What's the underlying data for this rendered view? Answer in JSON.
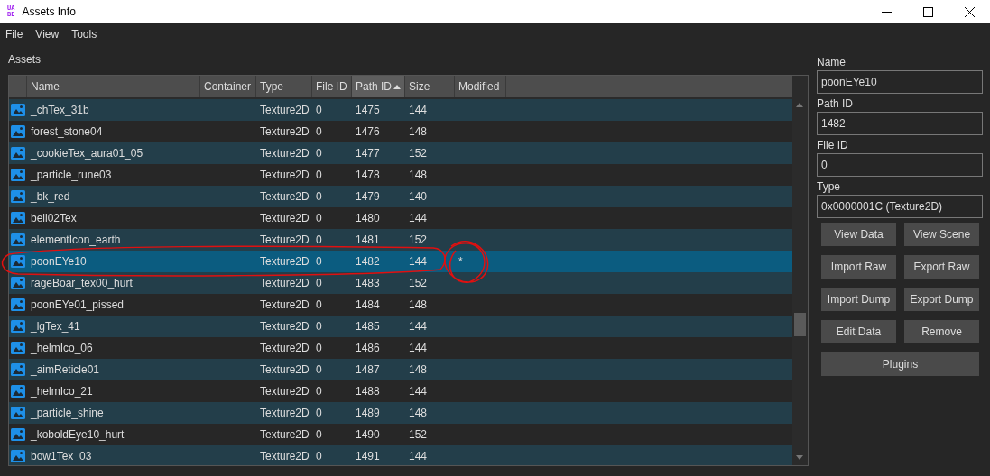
{
  "window": {
    "title": "Assets Info",
    "logo_lines": [
      "UA",
      "BE"
    ]
  },
  "menu": [
    "File",
    "View",
    "Tools"
  ],
  "section_label": "Assets",
  "table": {
    "columns": [
      {
        "label": "Name",
        "sorted_ascending": false
      },
      {
        "label": "Container",
        "sorted_ascending": false
      },
      {
        "label": "Type",
        "sorted_ascending": false
      },
      {
        "label": "File ID",
        "sorted_ascending": false
      },
      {
        "label": "Path ID",
        "sorted_ascending": true
      },
      {
        "label": "Size",
        "sorted_ascending": false
      },
      {
        "label": "Modified",
        "sorted_ascending": false
      }
    ],
    "rows": [
      {
        "name": "_chTex_31b",
        "type": "Texture2D",
        "file_id": "0",
        "path_id": "1475",
        "size": "144",
        "selected": false
      },
      {
        "name": "forest_stone04",
        "type": "Texture2D",
        "file_id": "0",
        "path_id": "1476",
        "size": "148",
        "selected": false
      },
      {
        "name": "_cookieTex_aura01_05",
        "type": "Texture2D",
        "file_id": "0",
        "path_id": "1477",
        "size": "152",
        "selected": false
      },
      {
        "name": "_particle_rune03",
        "type": "Texture2D",
        "file_id": "0",
        "path_id": "1478",
        "size": "148",
        "selected": false
      },
      {
        "name": "_bk_red",
        "type": "Texture2D",
        "file_id": "0",
        "path_id": "1479",
        "size": "140",
        "selected": false
      },
      {
        "name": "bell02Tex",
        "type": "Texture2D",
        "file_id": "0",
        "path_id": "1480",
        "size": "144",
        "selected": false
      },
      {
        "name": "elementIcon_earth",
        "type": "Texture2D",
        "file_id": "0",
        "path_id": "1481",
        "size": "152",
        "selected": false
      },
      {
        "name": "poonEYe10",
        "type": "Texture2D",
        "file_id": "0",
        "path_id": "1482",
        "size": "144",
        "modified": "*",
        "selected": true
      },
      {
        "name": "rageBoar_tex00_hurt",
        "type": "Texture2D",
        "file_id": "0",
        "path_id": "1483",
        "size": "152",
        "selected": false
      },
      {
        "name": "poonEYe01_pissed",
        "type": "Texture2D",
        "file_id": "0",
        "path_id": "1484",
        "size": "148",
        "selected": false
      },
      {
        "name": "_lgTex_41",
        "type": "Texture2D",
        "file_id": "0",
        "path_id": "1485",
        "size": "144",
        "selected": false
      },
      {
        "name": "_helmIco_06",
        "type": "Texture2D",
        "file_id": "0",
        "path_id": "1486",
        "size": "144",
        "selected": false
      },
      {
        "name": "_aimReticle01",
        "type": "Texture2D",
        "file_id": "0",
        "path_id": "1487",
        "size": "148",
        "selected": false
      },
      {
        "name": "_helmIco_21",
        "type": "Texture2D",
        "file_id": "0",
        "path_id": "1488",
        "size": "144",
        "selected": false
      },
      {
        "name": "_particle_shine",
        "type": "Texture2D",
        "file_id": "0",
        "path_id": "1489",
        "size": "148",
        "selected": false
      },
      {
        "name": "_koboldEye10_hurt",
        "type": "Texture2D",
        "file_id": "0",
        "path_id": "1490",
        "size": "152",
        "selected": false
      },
      {
        "name": "bow1Tex_03",
        "type": "Texture2D",
        "file_id": "0",
        "path_id": "1491",
        "size": "144",
        "selected": false
      }
    ]
  },
  "details": {
    "fields": [
      {
        "label": "Name",
        "value": "poonEYe10"
      },
      {
        "label": "Path ID",
        "value": "1482"
      },
      {
        "label": "File ID",
        "value": "0"
      },
      {
        "label": "Type",
        "value": "0x0000001C (Texture2D)"
      }
    ],
    "buttons": [
      "View Data",
      "View Scene",
      "Import Raw",
      "Export Raw",
      "Import Dump",
      "Export Dump",
      "Edit Data",
      "Remove"
    ],
    "wide_button": "Plugins"
  }
}
